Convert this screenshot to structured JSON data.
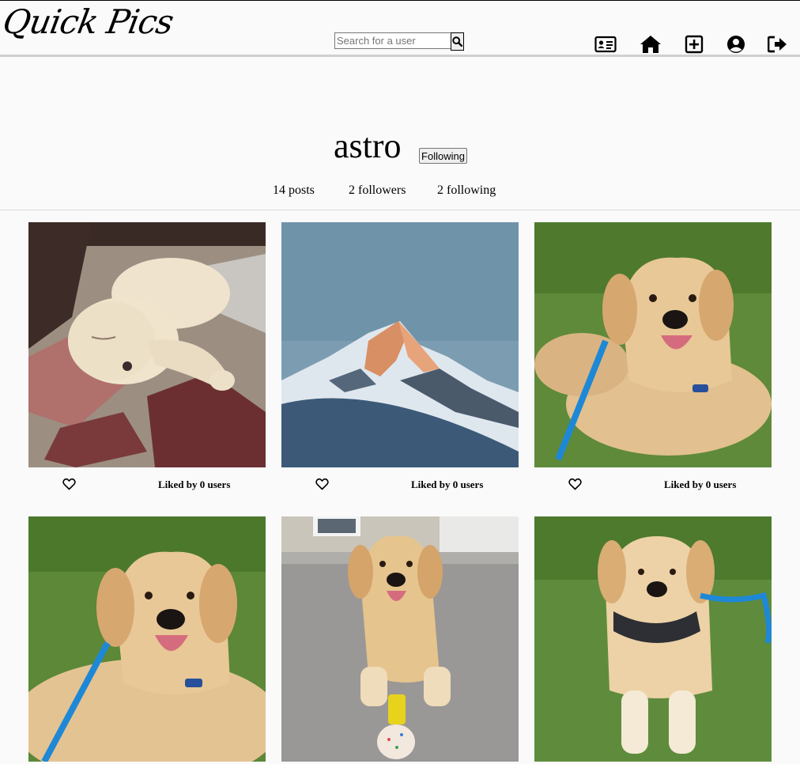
{
  "app": {
    "logo_text": "Quick Pics"
  },
  "navbar": {
    "search": {
      "placeholder": "Search for a user",
      "value": ""
    },
    "icons": [
      "id-card-icon",
      "home-icon",
      "add-post-icon",
      "user-circle-icon",
      "sign-out-icon"
    ]
  },
  "profile": {
    "username": "astro",
    "follow_button_label": "Following",
    "stats": {
      "posts": "14 posts",
      "followers": "2 followers",
      "following": "2 following"
    }
  },
  "posts": [
    {
      "image": "sleeping golden retriever puppy on a patterned rug",
      "likes_text": "Liked by 0 users"
    },
    {
      "image": "snowy mountain peak at sunset under a blue sky",
      "likes_text": "Liked by 0 users"
    },
    {
      "image": "golden retriever lying on grass with blue leash",
      "likes_text": "Liked by 0 users"
    },
    {
      "image": "golden retriever lying on grass, close up",
      "likes_text": ""
    },
    {
      "image": "golden retriever on concrete patio with birthday cupcake",
      "likes_text": ""
    },
    {
      "image": "golden retriever puppy lying on grass with harness",
      "likes_text": ""
    }
  ],
  "colors": {
    "background": "#fafafa",
    "grass": "#5f8a3a",
    "dog": "#e2c08f",
    "sky": "#6f93a9",
    "leash": "#1e88d6"
  }
}
